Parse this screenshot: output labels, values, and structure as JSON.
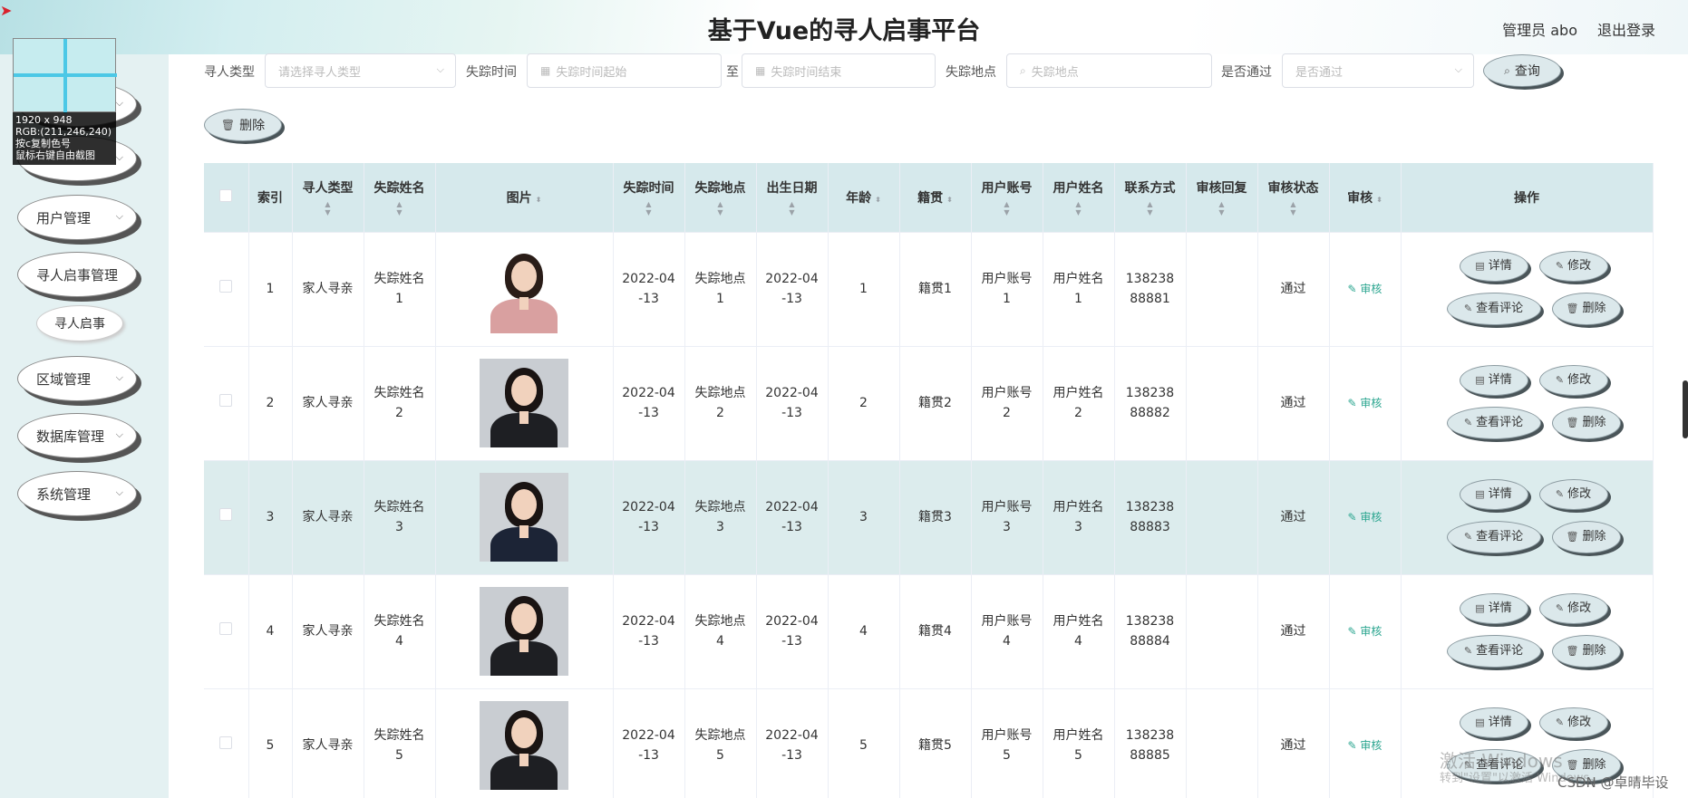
{
  "header": {
    "title": "基于Vue的寻人启事平台",
    "admin": "管理员 abo",
    "logout": "退出登录"
  },
  "sidebar": {
    "items": [
      {
        "label": ""
      },
      {
        "label": ""
      },
      {
        "label": "用户管理"
      },
      {
        "label": "寻人启事管理"
      },
      {
        "label": "区域管理"
      },
      {
        "label": "数据库管理"
      },
      {
        "label": "系统管理"
      }
    ],
    "sub_item": "寻人启事"
  },
  "capture_tool": {
    "size": "1920 x 948",
    "rgb": "RGB:(211,246,240)",
    "hint1": "按c复制色号",
    "hint2": "鼠标右键自由截图"
  },
  "filters": {
    "type_label": "寻人类型",
    "type_placeholder": "请选择寻人类型",
    "time_label": "失踪时间",
    "time_start_placeholder": "失踪时间起始",
    "time_to": "至",
    "time_end_placeholder": "失踪时间结束",
    "place_label": "失踪地点",
    "place_placeholder": "失踪地点",
    "pass_label": "是否通过",
    "pass_placeholder": "是否通过",
    "query": "查询",
    "delete": "删除"
  },
  "table": {
    "headers": [
      "索引",
      "寻人类型",
      "失踪姓名",
      "图片",
      "失踪时间",
      "失踪地点",
      "出生日期",
      "年龄",
      "籍贯",
      "用户账号",
      "用户姓名",
      "联系方式",
      "审核回复",
      "审核状态",
      "审核",
      "操作"
    ],
    "rows": [
      {
        "index": "1",
        "type": "家人寻亲",
        "name": "失踪姓名1",
        "time": "2022-04-13",
        "place": "失踪地点1",
        "birth": "2022-04-13",
        "age": "1",
        "origin": "籍贯1",
        "account": "用户账号1",
        "uname": "用户姓名1",
        "phone": "13823888881",
        "reply": "",
        "status": "通过",
        "audit": "审核"
      },
      {
        "index": "2",
        "type": "家人寻亲",
        "name": "失踪姓名2",
        "time": "2022-04-13",
        "place": "失踪地点2",
        "birth": "2022-04-13",
        "age": "2",
        "origin": "籍贯2",
        "account": "用户账号2",
        "uname": "用户姓名2",
        "phone": "13823888882",
        "reply": "",
        "status": "通过",
        "audit": "审核"
      },
      {
        "index": "3",
        "type": "家人寻亲",
        "name": "失踪姓名3",
        "time": "2022-04-13",
        "place": "失踪地点3",
        "birth": "2022-04-13",
        "age": "3",
        "origin": "籍贯3",
        "account": "用户账号3",
        "uname": "用户姓名3",
        "phone": "13823888883",
        "reply": "",
        "status": "通过",
        "audit": "审核"
      },
      {
        "index": "4",
        "type": "家人寻亲",
        "name": "失踪姓名4",
        "time": "2022-04-13",
        "place": "失踪地点4",
        "birth": "2022-04-13",
        "age": "4",
        "origin": "籍贯4",
        "account": "用户账号4",
        "uname": "用户姓名4",
        "phone": "13823888884",
        "reply": "",
        "status": "通过",
        "audit": "审核"
      },
      {
        "index": "5",
        "type": "家人寻亲",
        "name": "失踪姓名5",
        "time": "2022-04-13",
        "place": "失踪地点5",
        "birth": "2022-04-13",
        "age": "5",
        "origin": "籍贯5",
        "account": "用户账号5",
        "uname": "用户姓名5",
        "phone": "13823888885",
        "reply": "",
        "status": "通过",
        "audit": "审核"
      }
    ],
    "op_detail": "详情",
    "op_edit": "修改",
    "op_comments": "查看评论",
    "op_delete": "删除"
  },
  "watermark": {
    "line1": "激活 Windows",
    "line2": "转到\"设置\"以激活 Windows。",
    "csdn": "CSDN @卓晴毕设"
  },
  "colors": {
    "header_band": "#d3eef0",
    "sidebar_bg": "#e4f1f2",
    "table_header_bg": "#d6e9ec",
    "highlight_row": "#dceced",
    "audit_link": "#2aa58f"
  }
}
